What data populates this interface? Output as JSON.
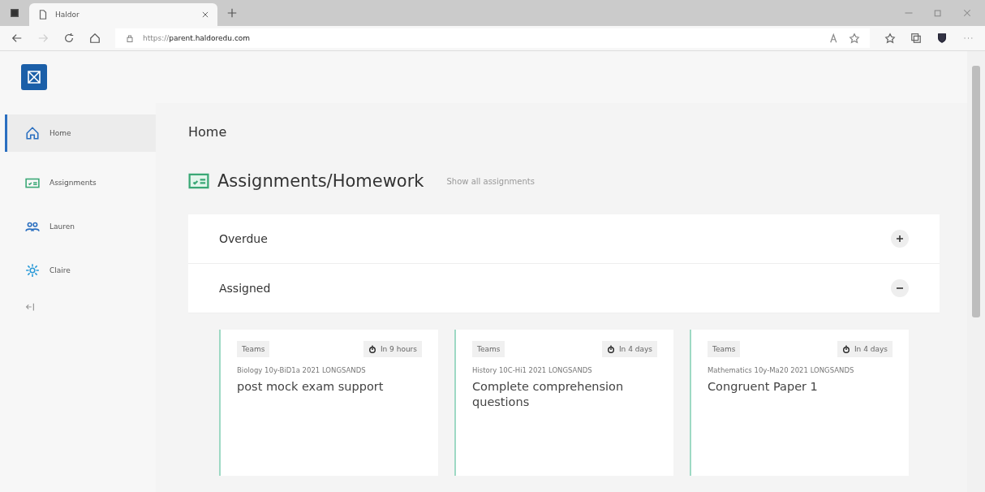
{
  "browser": {
    "tab_title": "Haldor",
    "url_prefix": "https://",
    "url_host": "parent.haldoredu.com"
  },
  "sidebar": {
    "items": [
      {
        "label": "Home",
        "selected": true
      },
      {
        "label": "Assignments",
        "selected": false
      },
      {
        "label": "Lauren",
        "selected": false
      },
      {
        "label": "Claire",
        "selected": false
      }
    ]
  },
  "page": {
    "title": "Home"
  },
  "section": {
    "title": "Assignments/Homework",
    "link": "Show all assignments"
  },
  "groups": [
    {
      "label": "Overdue",
      "expanded": false
    },
    {
      "label": "Assigned",
      "expanded": true
    }
  ],
  "cards": [
    {
      "tag": "Teams",
      "due": "In 9 hours",
      "course": "Biology 10y-BiD1a 2021 LONGSANDS",
      "title": "post mock exam support"
    },
    {
      "tag": "Teams",
      "due": "In 4 days",
      "course": "History 10C-Hi1 2021 LONGSANDS",
      "title": "Complete comprehension questions"
    },
    {
      "tag": "Teams",
      "due": "In 4 days",
      "course": "Mathematics 10y-Ma20 2021 LONGSANDS",
      "title": "Congruent Paper 1"
    }
  ]
}
